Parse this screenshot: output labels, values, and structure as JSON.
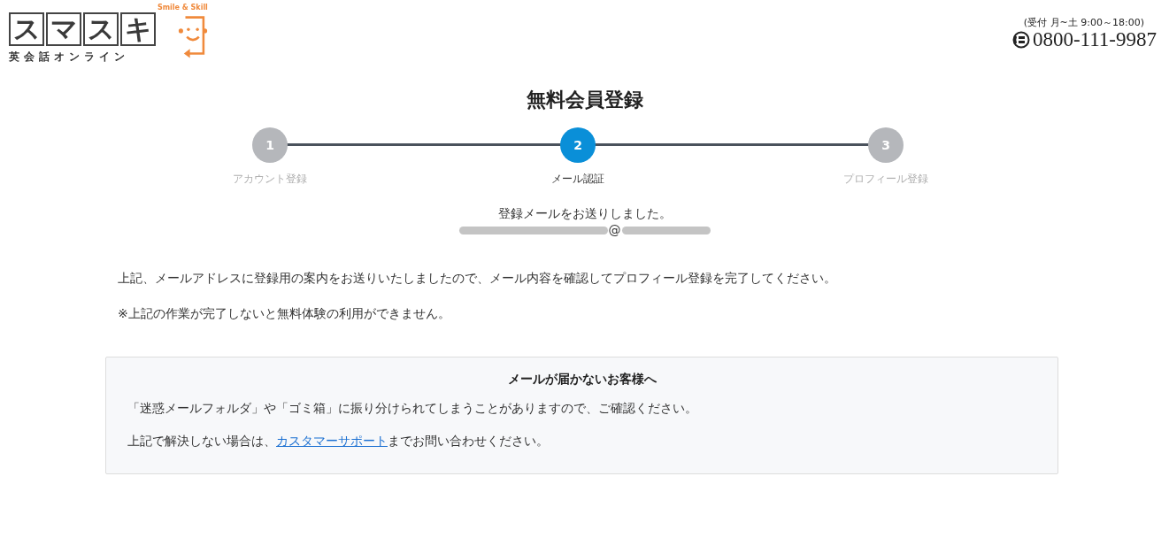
{
  "header": {
    "logo": {
      "letters": [
        "ス",
        "マ",
        "ス",
        "キ"
      ],
      "subtitle": "英会話オンライン",
      "tagline": "Smile & Skill"
    },
    "contact": {
      "hours": "(受付 月~土 9:00～18:00)",
      "phone": "0800-111-9987"
    }
  },
  "title": "無料会員登録",
  "steps": [
    {
      "number": "1",
      "label": "アカウント登録",
      "selected": false
    },
    {
      "number": "2",
      "label": "メール認証",
      "selected": true
    },
    {
      "number": "3",
      "label": "プロフィール登録",
      "selected": false
    }
  ],
  "sent_message": "登録メールをお送りしました。",
  "email": {
    "visible": "@"
  },
  "paragraphs": [
    "上記、メールアドレスに登録用の案内をお送りいたしましたので、メール内容を確認してプロフィール登録を完了してください。",
    "※上記の作業が完了しないと無料体験の利用ができません。"
  ],
  "notice": {
    "title": "メールが届かないお客様へ",
    "lines": [
      {
        "text": "「迷惑メールフォルダ」や「ゴミ箱」に振り分けられてしまうことがありますので、ご確認ください。"
      },
      {
        "before": "上記で解決しない場合は、",
        "link": "カスタマーサポート",
        "after": "までお問い合わせください。"
      }
    ]
  }
}
